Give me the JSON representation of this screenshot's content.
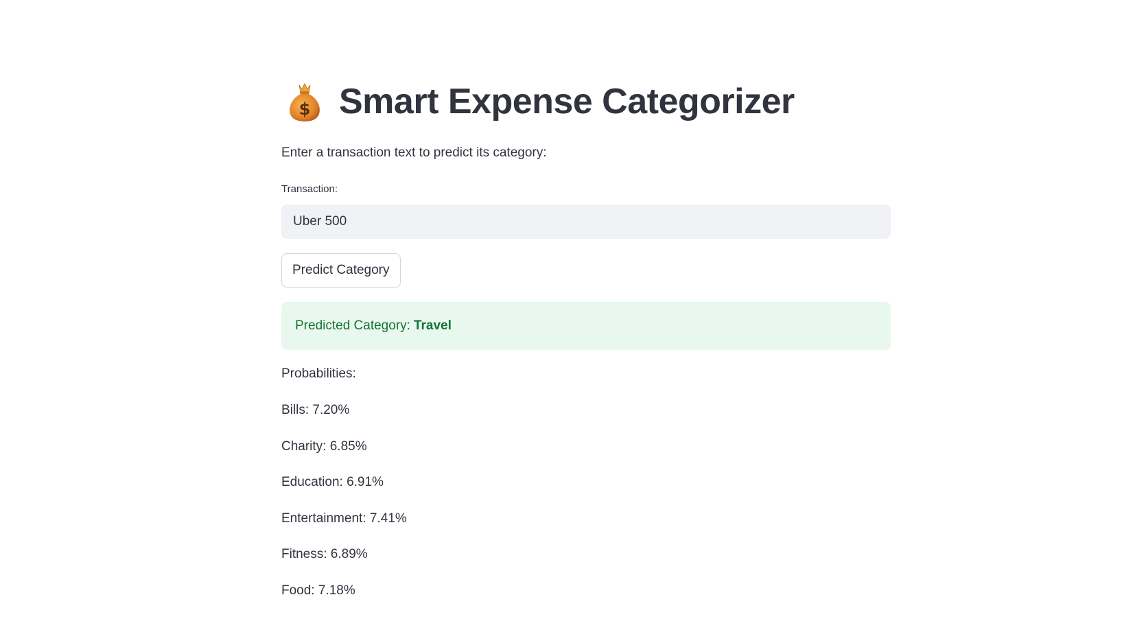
{
  "app": {
    "title": "Smart Expense Categorizer",
    "title_icon": "money-bag-icon",
    "subtitle": "Enter a transaction text to predict its category:"
  },
  "form": {
    "transaction_label": "Transaction:",
    "transaction_value": "Uber 500",
    "predict_button_label": "Predict Category"
  },
  "result": {
    "label": "Predicted Category:",
    "value": "Travel"
  },
  "probabilities": {
    "heading": "Probabilities:",
    "items": [
      {
        "text": "Bills: 7.20%"
      },
      {
        "text": "Charity: 6.85%"
      },
      {
        "text": "Education: 6.91%"
      },
      {
        "text": "Entertainment: 7.41%"
      },
      {
        "text": "Fitness: 6.89%"
      },
      {
        "text": "Food: 7.18%"
      }
    ]
  },
  "colors": {
    "text": "#31333f",
    "input_background": "#f0f2f6",
    "success_background": "#e8f8ee",
    "success_text": "#177233"
  }
}
